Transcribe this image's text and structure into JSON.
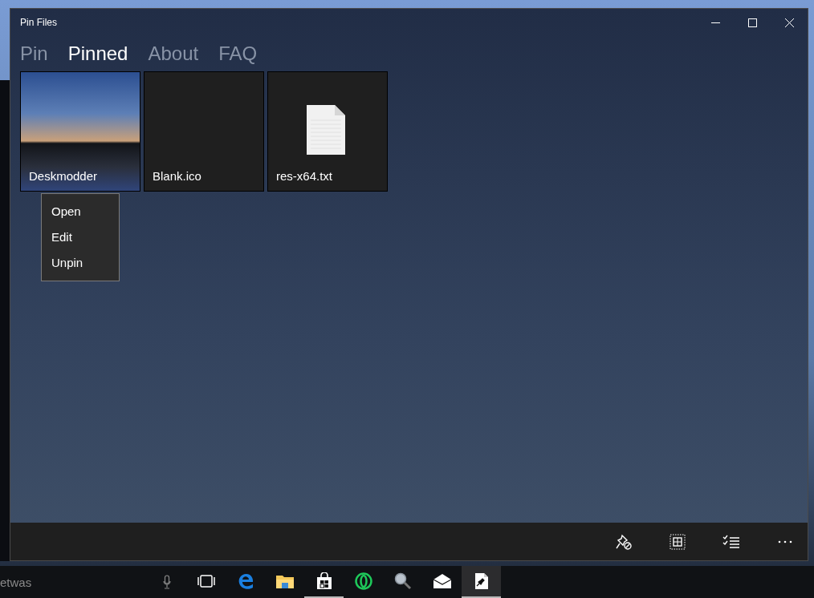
{
  "window": {
    "title": "Pin Files"
  },
  "tabs": [
    {
      "label": "Pin",
      "selected": false
    },
    {
      "label": "Pinned",
      "selected": true
    },
    {
      "label": "About",
      "selected": false
    },
    {
      "label": "FAQ",
      "selected": false
    }
  ],
  "tiles": [
    {
      "name": "Deskmodder",
      "kind": "photo"
    },
    {
      "name": "Blank.ico",
      "kind": "blank"
    },
    {
      "name": "res-x64.txt",
      "kind": "document"
    }
  ],
  "context_menu": {
    "items": [
      "Open",
      "Edit",
      "Unpin"
    ]
  },
  "app_bar": {
    "buttons": [
      {
        "kind": "unpin"
      },
      {
        "kind": "select"
      },
      {
        "kind": "checklist"
      },
      {
        "kind": "more"
      }
    ]
  },
  "taskbar": {
    "search": {
      "placeholder": "etwas"
    },
    "apps": [
      {
        "kind": "taskview",
        "running": false,
        "selected": false
      },
      {
        "kind": "edge",
        "running": false,
        "selected": false
      },
      {
        "kind": "explorer",
        "running": false,
        "selected": false
      },
      {
        "kind": "store",
        "running": true,
        "selected": false
      },
      {
        "kind": "opera",
        "running": false,
        "selected": false
      },
      {
        "kind": "search",
        "running": false,
        "selected": false
      },
      {
        "kind": "mail",
        "running": false,
        "selected": false
      },
      {
        "kind": "pinfiles",
        "running": true,
        "selected": true
      }
    ]
  }
}
